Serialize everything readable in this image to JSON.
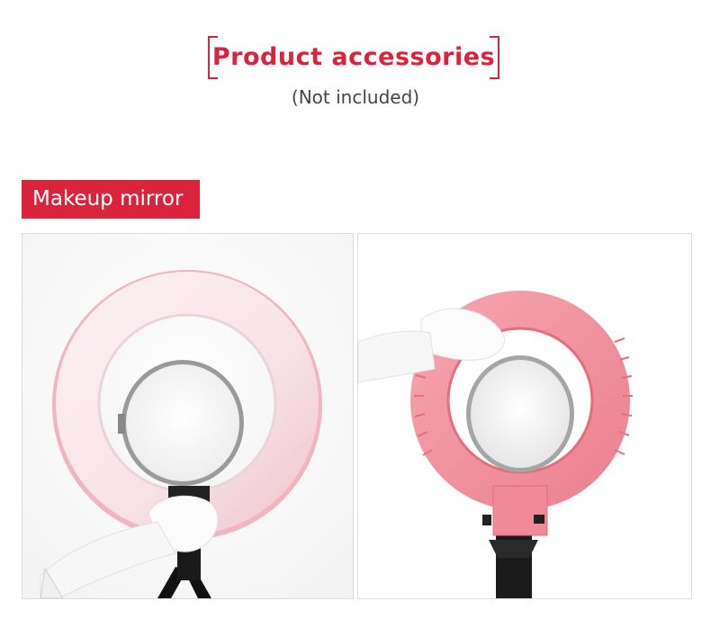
{
  "header": {
    "title": "Product accessories",
    "subtitle": "(Not included)"
  },
  "section": {
    "tag": "Makeup mirror"
  },
  "photos": [
    {
      "name": "white-ring-light-with-mirror-photo"
    },
    {
      "name": "pink-ring-light-with-mirror-photo"
    }
  ],
  "colors": {
    "accent": "#d9243b",
    "ring_pink": "#f08a96",
    "ring_white": "#fbeef0"
  }
}
